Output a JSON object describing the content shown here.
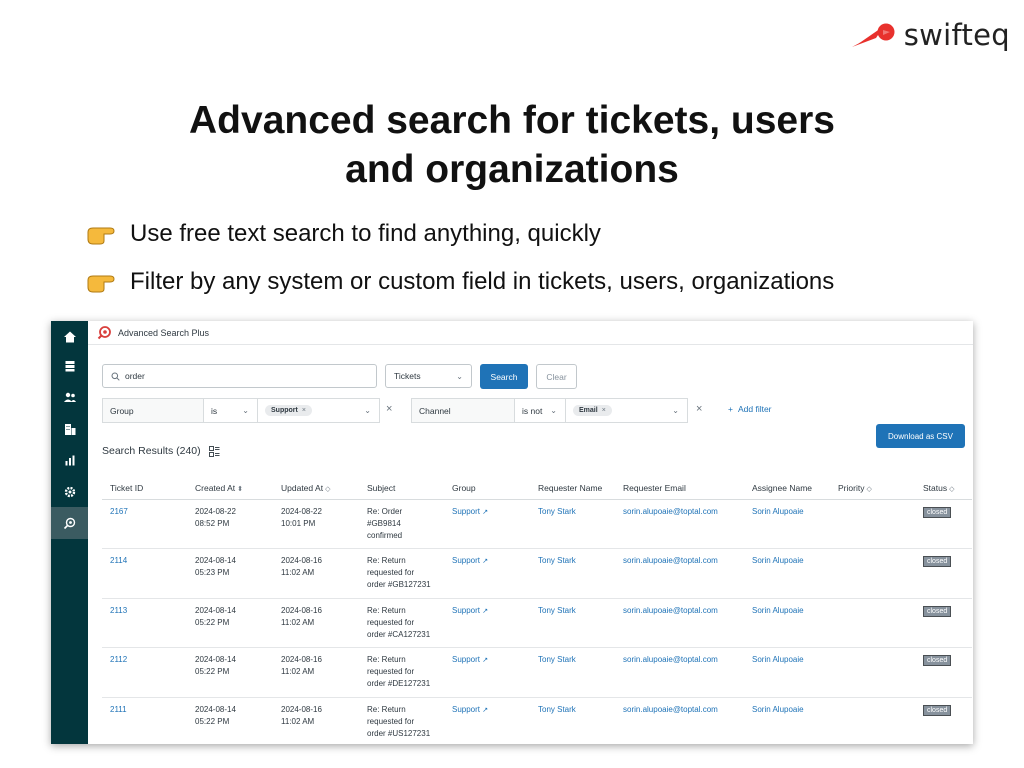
{
  "brand": {
    "name": "swifteq",
    "accent": "#e8312d"
  },
  "slide": {
    "title_line1": "Advanced search for tickets, users",
    "title_line2": "and organizations",
    "bullets": [
      "Use free text search to find anything, quickly",
      "Filter by any system or custom field in tickets, users, organizations"
    ]
  },
  "app": {
    "title": "Advanced Search Plus",
    "sidebar_icons": [
      "home-icon",
      "views-icon",
      "customers-icon",
      "organizations-icon",
      "reporting-icon",
      "admin-gear-icon",
      "advanced-search-app-icon"
    ],
    "search": {
      "value": "order",
      "type_select": "Tickets",
      "search_label": "Search",
      "clear_label": "Clear"
    },
    "filters": [
      {
        "field": "Group",
        "operator": "is",
        "value": "Support"
      },
      {
        "field": "Channel",
        "operator": "is not",
        "value": "Email"
      }
    ],
    "add_filter_label": "Add filter",
    "download_label": "Download as CSV",
    "results_title": "Search Results (240)",
    "columns": [
      "Ticket ID",
      "Created At",
      "Updated At",
      "Subject",
      "Group",
      "Requester Name",
      "Requester Email",
      "Assignee Name",
      "Priority",
      "Status"
    ],
    "rows": [
      {
        "id": "2167",
        "created_date": "2024-08-22",
        "created_time": "08:52 PM",
        "updated_date": "2024-08-22",
        "updated_time": "10:01 PM",
        "subject": [
          "Re: Order",
          "#GB9814",
          "confirmed"
        ],
        "group": "Support",
        "requester": "Tony Stark",
        "email": "sorin.alupoaie@toptal.com",
        "assignee": "Sorin Alupoaie",
        "priority": "",
        "status": "closed"
      },
      {
        "id": "2114",
        "created_date": "2024-08-14",
        "created_time": "05:23 PM",
        "updated_date": "2024-08-16",
        "updated_time": "11:02 AM",
        "subject": [
          "Re: Return",
          "requested for",
          "order #GB127231"
        ],
        "group": "Support",
        "requester": "Tony Stark",
        "email": "sorin.alupoaie@toptal.com",
        "assignee": "Sorin Alupoaie",
        "priority": "",
        "status": "closed"
      },
      {
        "id": "2113",
        "created_date": "2024-08-14",
        "created_time": "05:22 PM",
        "updated_date": "2024-08-16",
        "updated_time": "11:02 AM",
        "subject": [
          "Re: Return",
          "requested for",
          "order #CA127231"
        ],
        "group": "Support",
        "requester": "Tony Stark",
        "email": "sorin.alupoaie@toptal.com",
        "assignee": "Sorin Alupoaie",
        "priority": "",
        "status": "closed"
      },
      {
        "id": "2112",
        "created_date": "2024-08-14",
        "created_time": "05:22 PM",
        "updated_date": "2024-08-16",
        "updated_time": "11:02 AM",
        "subject": [
          "Re: Return",
          "requested for",
          "order #DE127231"
        ],
        "group": "Support",
        "requester": "Tony Stark",
        "email": "sorin.alupoaie@toptal.com",
        "assignee": "Sorin Alupoaie",
        "priority": "",
        "status": "closed"
      },
      {
        "id": "2111",
        "created_date": "2024-08-14",
        "created_time": "05:22 PM",
        "updated_date": "2024-08-16",
        "updated_time": "11:02 AM",
        "subject": [
          "Re: Return",
          "requested for",
          "order #US127231"
        ],
        "group": "Support",
        "requester": "Tony Stark",
        "email": "sorin.alupoaie@toptal.com",
        "assignee": "Sorin Alupoaie",
        "priority": "",
        "status": "closed"
      }
    ]
  }
}
